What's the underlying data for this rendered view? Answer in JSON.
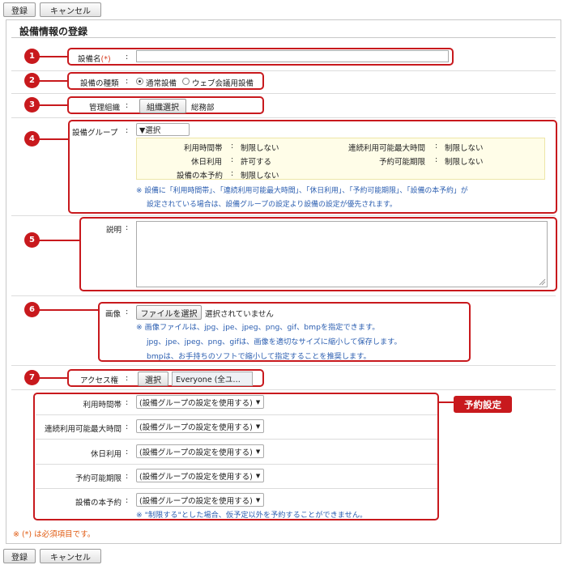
{
  "toolbar": {
    "register": "登録",
    "cancel": "キャンセル"
  },
  "title": "設備情報の登録",
  "fields": {
    "name": {
      "label": "設備名",
      "required": "(*)",
      "colon": ":",
      "value": ""
    },
    "type": {
      "label": "設備の種類",
      "colon": ":",
      "options": [
        "通常設備",
        "ウェブ会議用設備"
      ],
      "selected": "通常設備"
    },
    "org": {
      "label": "管理組織",
      "colon": ":",
      "button": "組織選択",
      "value": "総務部"
    },
    "group": {
      "label": "設備グループ",
      "colon": ":",
      "select": "▼選択",
      "rows": [
        {
          "label": "利用時間帯",
          "colon": ":",
          "value": "制限しない"
        },
        {
          "label": "休日利用",
          "colon": ":",
          "value": "許可する"
        },
        {
          "label": "設備の本予約",
          "colon": ":",
          "value": "制限しない"
        }
      ],
      "rows_right": [
        {
          "label": "連続利用可能最大時間",
          "colon": ":",
          "value": "制限しない"
        },
        {
          "label": "予約可能期限",
          "colon": ":",
          "value": "制限しない"
        }
      ],
      "note1": "※ 設備に「利用時間帯」、「連続利用可能最大時間」、「休日利用」、「予約可能期限」、「設備の本予約」が",
      "note2": "設定されている場合は、設備グループの設定より設備の設定が優先されます。"
    },
    "desc": {
      "label": "説明",
      "colon": ":",
      "value": ""
    },
    "image": {
      "label": "画像",
      "colon": ":",
      "button": "ファイルを選択",
      "status": "選択されていません",
      "note1": "※ 画像ファイルは、jpg、jpe、jpeg、png、gif、bmpを指定できます。",
      "note2": "jpg、jpe、jpeg、png、gifは、画像を適切なサイズに縮小して保存します。",
      "note3": "bmpは、お手持ちのソフトで縮小して指定することを推奨します。"
    },
    "access": {
      "label": "アクセス権",
      "colon": ":",
      "button": "選択",
      "value": "Everyone (全ユ…"
    }
  },
  "reservation": {
    "badge": "予約設定",
    "items": [
      {
        "label": "利用時間帯",
        "colon": ":",
        "value": "(設備グループの設定を使用する)"
      },
      {
        "label": "連続利用可能最大時間",
        "colon": ":",
        "value": "(設備グループの設定を使用する)"
      },
      {
        "label": "休日利用",
        "colon": ":",
        "value": "(設備グループの設定を使用する)"
      },
      {
        "label": "予約可能期限",
        "colon": ":",
        "value": "(設備グループの設定を使用する)"
      },
      {
        "label": "設備の本予約",
        "colon": ":",
        "value": "(設備グループの設定を使用する)"
      }
    ],
    "note": "※ \"制限する\"とした場合、仮予定以外を予約することができません。"
  },
  "footer_note": "※ (*) は必須項目です。",
  "markers": [
    "1",
    "2",
    "3",
    "4",
    "5",
    "6",
    "7"
  ],
  "colors": {
    "accent": "#c8191d",
    "note": "#2a5db0",
    "info_bg": "#fffde8",
    "info_border": "#ede6a8"
  }
}
